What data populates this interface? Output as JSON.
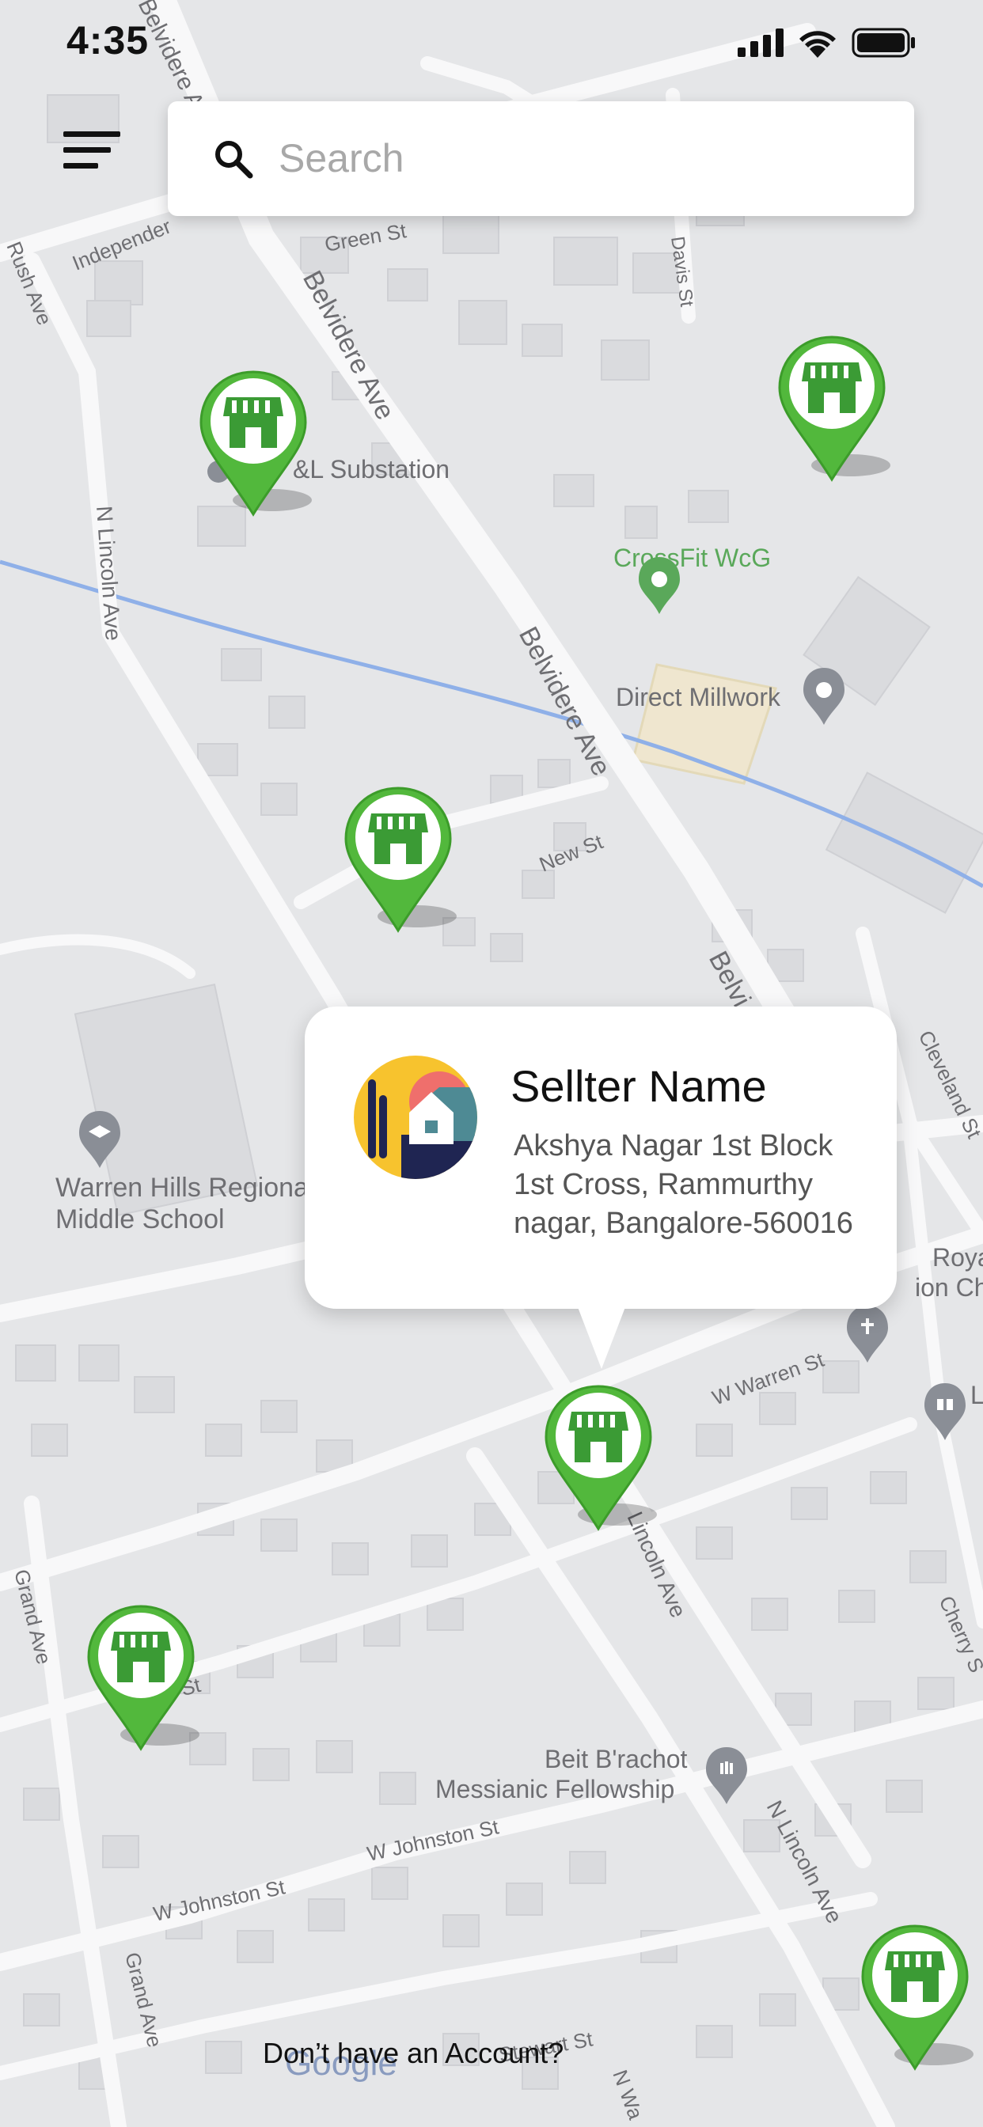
{
  "status_bar": {
    "time": "4:35"
  },
  "search": {
    "placeholder": "Search"
  },
  "popup": {
    "seller_name": "Sellter Name",
    "address": "Akshya Nagar 1st Block 1st Cross, Rammurthy nagar, Bangalore-560016"
  },
  "map": {
    "streets": {
      "belvidere_top": "Belvidere A",
      "belvidere_mid": "Belvidere Ave",
      "belvidere_lower": "Belvidere Ave",
      "belvidere_bottom": "Belvi",
      "green_st": "Green St",
      "independence": "Independer",
      "rush_ave": "Rush Ave",
      "davis_st": "Davis St",
      "n_lincoln_ave_left": "N Lincoln Ave",
      "new_st": "New St",
      "cleveland": "Cleveland St",
      "w_warren_st": "W Warren St",
      "lincoln_ave_mid": "Lincoln Ave",
      "grand_ave_top": "Grand Ave",
      "grand_ave_bottom": "Grand Ave",
      "w_johnston_right": "W Johnston St",
      "w_johnston_left": "W Johnston St",
      "n_lincoln_ave_right": "N Lincoln Ave",
      "cherry": "Cherry S",
      "stewart": "Stewart St",
      "n_wa": "N Wa",
      "en_st": "en St"
    },
    "pois": {
      "substation": "&L Substation",
      "crossfit": "CrossFit WcG",
      "millwork": "Direct Millwork",
      "warren_hills_1": "Warren Hills Regiona",
      "warren_hills_2": "Middle School",
      "royal_1": "Royal",
      "royal_2": "ion Cha",
      "beit_1": "Beit B'rachot",
      "beit_2": "Messianic Fellowship",
      "library": "L"
    },
    "attribution": "Google",
    "colors": {
      "water": "#8fb0e8",
      "road": "#f7f7f8",
      "building": "#d9dadd",
      "poi_green": "#5aa85a",
      "marker_green": "#52b83c"
    }
  },
  "markers": [
    {
      "name": "store-marker-1"
    },
    {
      "name": "store-marker-2"
    },
    {
      "name": "store-marker-3"
    },
    {
      "name": "store-marker-4"
    },
    {
      "name": "store-marker-5"
    },
    {
      "name": "store-marker-6"
    }
  ],
  "footer": {
    "text": "Don’t have an Account?"
  }
}
